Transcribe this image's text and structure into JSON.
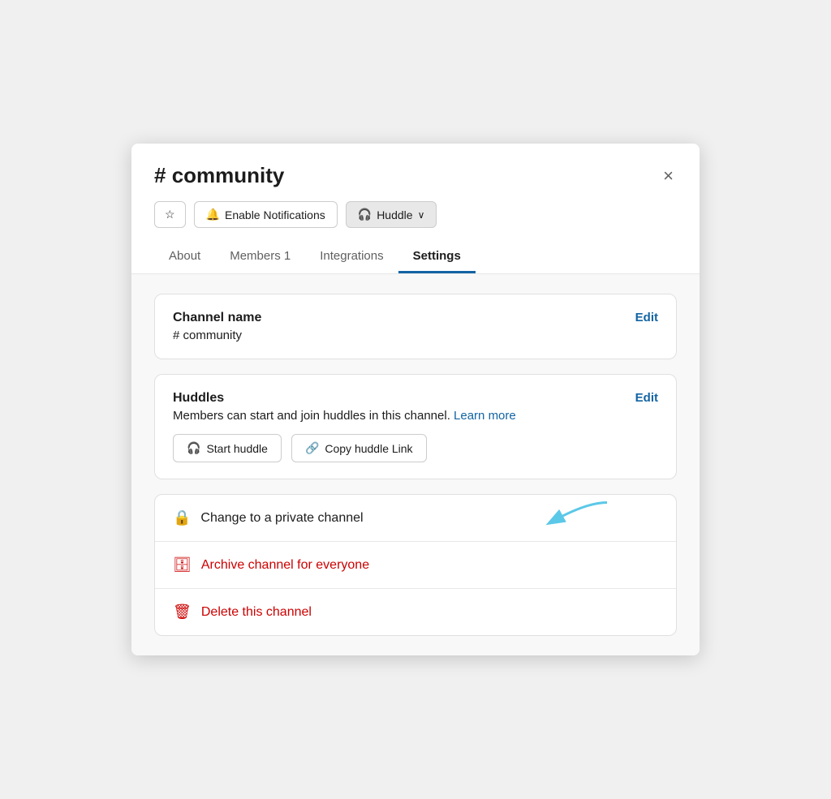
{
  "modal": {
    "title_hash": "#",
    "title_channel": "community",
    "close_label": "×"
  },
  "action_buttons": {
    "star_icon": "☆",
    "notifications_icon": "🔔",
    "notifications_label": "Enable Notifications",
    "huddle_icon": "🎧",
    "huddle_label": "Huddle",
    "huddle_chevron": "∨"
  },
  "tabs": [
    {
      "id": "about",
      "label": "About",
      "active": false
    },
    {
      "id": "members",
      "label": "Members 1",
      "active": false
    },
    {
      "id": "integrations",
      "label": "Integrations",
      "active": false
    },
    {
      "id": "settings",
      "label": "Settings",
      "active": true
    }
  ],
  "settings": {
    "channel_name_card": {
      "title": "Channel name",
      "value": "# community",
      "edit_label": "Edit"
    },
    "huddles_card": {
      "title": "Huddles",
      "edit_label": "Edit",
      "description_pre": "Members can start and join huddles in this channel.",
      "learn_more_label": "Learn more",
      "start_huddle_icon": "🎧",
      "start_huddle_label": "Start huddle",
      "copy_link_icon": "🔗",
      "copy_link_label": "Copy huddle Link"
    },
    "danger_section": {
      "private_channel_icon": "🔒",
      "private_channel_label": "Change to a private channel",
      "archive_icon": "🗄",
      "archive_label": "Archive channel for everyone",
      "delete_icon": "🗑",
      "delete_label": "Delete this channel"
    }
  },
  "colors": {
    "active_tab": "#1264a3",
    "edit_link": "#1264a3",
    "learn_more": "#1264a3",
    "red": "#cc0000",
    "arrow": "#5bc8e8"
  }
}
